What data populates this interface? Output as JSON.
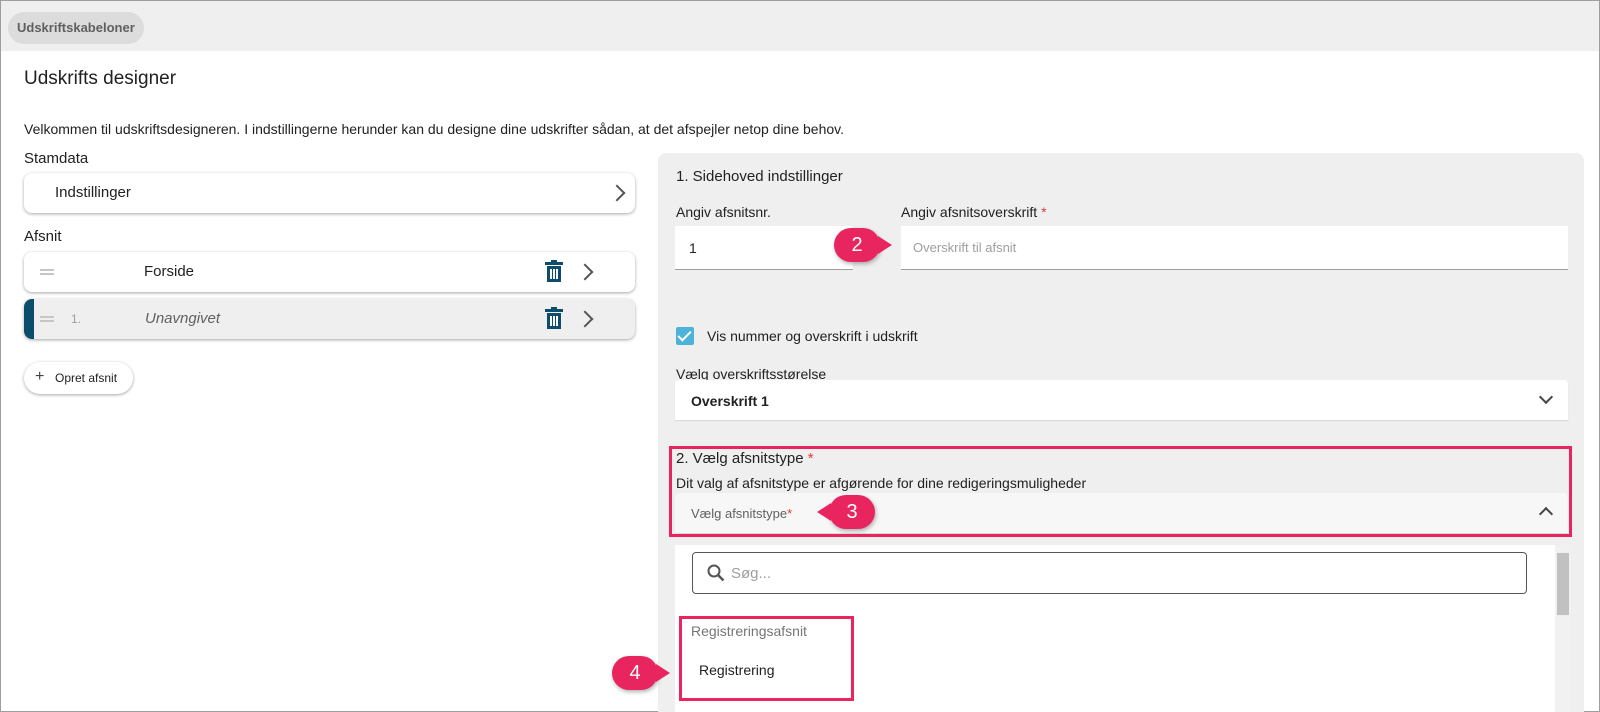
{
  "breadcrumb": {
    "label": "Udskriftskabeloner"
  },
  "page": {
    "title": "Udskrifts designer",
    "intro": "Velkommen til udskriftsdesigneren. I indstillingerne herunder kan du designe dine udskrifter sådan, at det afspejler netop dine behov."
  },
  "sidebar": {
    "stamdata_label": "Stamdata",
    "settings_label": "Indstillinger",
    "afsnit_label": "Afsnit",
    "sections": [
      {
        "number": "",
        "title": "Forside"
      },
      {
        "number": "1.",
        "title": "Unavngivet"
      }
    ],
    "add_label": "Opret afsnit"
  },
  "panel": {
    "header_title": "1. Sidehoved indstillinger",
    "number_label": "Angiv afsnitsnr.",
    "number_value": "1",
    "heading_label": "Angiv afsnitsoverskrift",
    "heading_required": "*",
    "heading_placeholder": "Overskrift til afsnit",
    "show_checkbox_label": "Vis nummer og overskrift i udskrift",
    "show_checkbox_checked": true,
    "size_label": "Vælg overskriftsstørelse",
    "size_value": "Overskrift 1",
    "type_title": "2. Vælg afsnitstype",
    "type_required": "*",
    "type_hint": "Dit valg af afsnitstype er afgørende for dine redigeringsmuligheder",
    "type_placeholder": "Vælg afsnitstype",
    "type_placeholder_required": "*"
  },
  "dropdown": {
    "search_placeholder": "Søg...",
    "group_label": "Registreringsafsnit",
    "option_label": "Registrering"
  },
  "callouts": [
    "2",
    "3",
    "4"
  ],
  "colors": {
    "accent": "#0b4d6b",
    "highlight": "#e8255f",
    "checkbox": "#4fb3d9",
    "panel_bg": "#efefef"
  }
}
